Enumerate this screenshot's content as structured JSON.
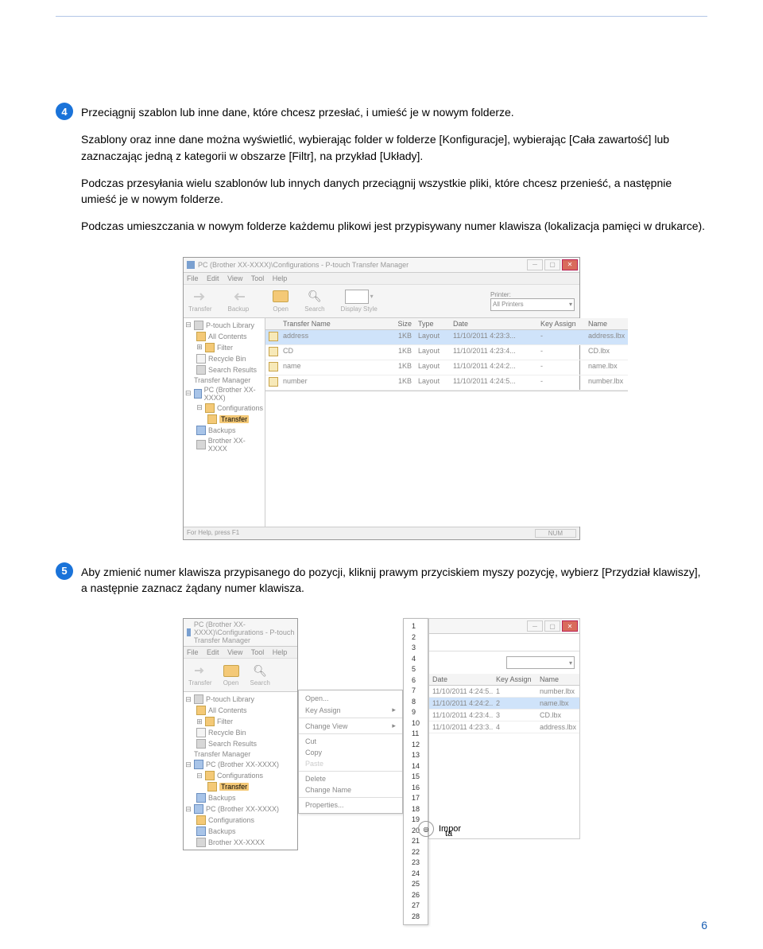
{
  "line_color": "#b3c6e7",
  "page_number": "6",
  "step4": {
    "num": "4",
    "p1": "Przeciągnij szablon lub inne dane, które chcesz przesłać, i umieść je w nowym folderze.",
    "p2": "Szablony oraz inne dane można wyświetlić, wybierając folder w folderze [Konfiguracje], wybierając [Cała zawartość] lub zaznaczając jedną z kategorii w obszarze [Filtr], na przykład [Układy].",
    "p3": "Podczas przesyłania wielu szablonów lub innych danych przeciągnij wszystkie pliki, które chcesz przenieść, a następnie umieść je w nowym folderze.",
    "p4": "Podczas umieszczania w nowym folderze każdemu plikowi jest przypisywany numer klawisza (lokalizacja pamięci w drukarce)."
  },
  "step5": {
    "num": "5",
    "p1": "Aby zmienić numer klawisza przypisanego do pozycji, kliknij prawym przyciskiem myszy pozycję, wybierz [Przydział klawiszy], a następnie zaznacz żądany numer klawisza."
  },
  "app": {
    "title": "PC (Brother XX-XXXX)\\Configurations - P-touch Transfer Manager",
    "menu": {
      "file": "File",
      "edit": "Edit",
      "view": "View",
      "tool": "Tool",
      "help": "Help"
    },
    "toolbar": {
      "transfer": "Transfer",
      "backup": "Backup",
      "open": "Open",
      "search": "Search",
      "display": "Display Style"
    },
    "printer_label": "Printer:",
    "printer_value": "All Printers",
    "tree": {
      "lib": "P-touch Library",
      "all": "All Contents",
      "filter": "Filter",
      "recycle": "Recycle Bin",
      "search": "Search Results",
      "tm": "Transfer Manager",
      "pc1": "PC (Brother XX-XXXX)",
      "config": "Configurations",
      "transfer": "Transfer",
      "backups": "Backups",
      "pc2": "PC (Brother XX-XXXX)",
      "brother": "Brother XX-XXXX"
    },
    "columns": {
      "name": "Transfer Name",
      "size": "Size",
      "type": "Type",
      "date": "Date",
      "key": "Key Assign",
      "file": "Name"
    },
    "rows": [
      {
        "name": "address",
        "size": "1KB",
        "type": "Layout",
        "date": "11/10/2011 4:23:3...",
        "key": "-",
        "file": "address.lbx"
      },
      {
        "name": "CD",
        "size": "1KB",
        "type": "Layout",
        "date": "11/10/2011 4:23:4...",
        "key": "-",
        "file": "CD.lbx"
      },
      {
        "name": "name",
        "size": "1KB",
        "type": "Layout",
        "date": "11/10/2011 4:24:2...",
        "key": "-",
        "file": "name.lbx"
      },
      {
        "name": "number",
        "size": "1KB",
        "type": "Layout",
        "date": "11/10/2011 4:24:5...",
        "key": "-",
        "file": "number.lbx"
      }
    ],
    "status_left": "For Help, press F1",
    "status_right": "NUM"
  },
  "app2": {
    "title": "PC (Brother XX-XXXX)\\Configurations - P-touch Transfer Manager",
    "tree": {
      "lib": "P-touch Library",
      "all": "All Contents",
      "filter": "Filter",
      "recycle": "Recycle Bin",
      "search": "Search Results",
      "tm": "Transfer Manager",
      "pc1": "PC (Brother XX-XXXX)",
      "config": "Configurations",
      "transfer": "Transfer",
      "backups": "Backups",
      "pc2": "PC (Brother XX-XXXX)",
      "config2": "Configurations",
      "backups2": "Backups",
      "brother": "Brother XX-XXXX"
    },
    "rows": [
      {
        "name": "number",
        "date": "11/10/2011 4:24:5...",
        "key": "1",
        "file": "number.lbx"
      },
      {
        "name": "name",
        "date": "11/10/2011 4:24:2...",
        "key": "2",
        "file": "name.lbx"
      },
      {
        "name": "CD",
        "date": "11/10/2011 4:23:4...",
        "key": "3",
        "file": "CD.lbx"
      },
      {
        "name": "address",
        "date": "11/10/2011 4:23:3...",
        "key": "4",
        "file": "address.lbx"
      }
    ],
    "ctx": {
      "open": "Open...",
      "key": "Key Assign",
      "changeview": "Change View",
      "cut": "Cut",
      "copy": "Copy",
      "paste": "Paste",
      "delete": "Delete",
      "changename": "Change Name",
      "properties": "Properties..."
    },
    "numbers": [
      "1",
      "2",
      "3",
      "4",
      "5",
      "6",
      "7",
      "8",
      "9",
      "10",
      "11",
      "12",
      "13",
      "14",
      "15",
      "16",
      "17",
      "18",
      "19",
      "20",
      "21",
      "22",
      "23",
      "24",
      "25",
      "26",
      "27",
      "28"
    ],
    "impor_label": "Impor",
    "impor_tail": "ta"
  }
}
